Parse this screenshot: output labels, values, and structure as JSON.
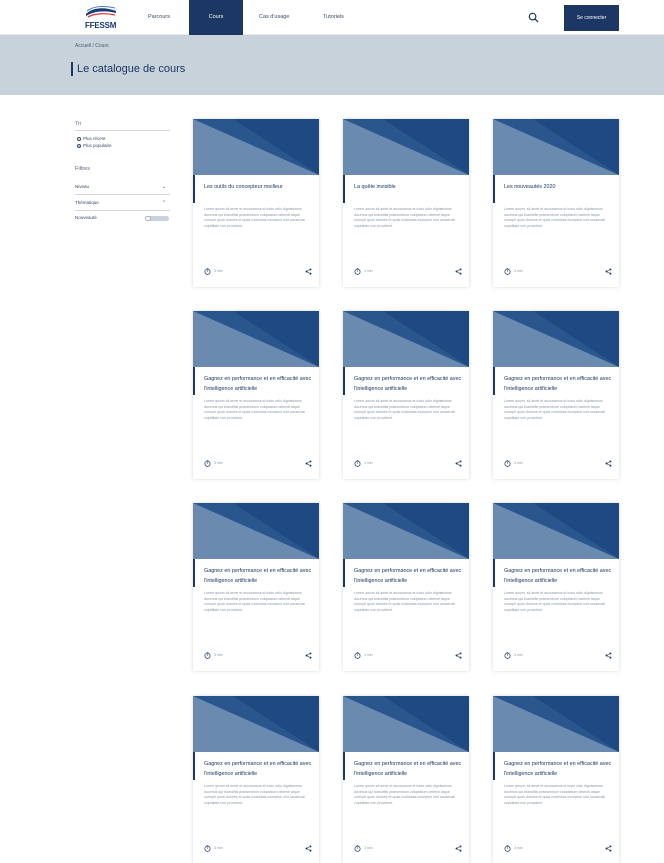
{
  "nav": {
    "logo_text": "FFESSM",
    "links": [
      {
        "label": "Parcours"
      },
      {
        "label": "Cours"
      },
      {
        "label": "Cas d'usage"
      },
      {
        "label": "Tutoriels"
      }
    ],
    "connect_label": "Se connecter"
  },
  "hero": {
    "breadcrumb": "Accueil / Cours",
    "title": "Le catalogue de cours"
  },
  "sidebar": {
    "sort_heading": "Tri",
    "sort_options": [
      {
        "label": "Plus récent",
        "checked": false
      },
      {
        "label": "Plus populaire",
        "checked": true
      }
    ],
    "filters_heading": "Filtres",
    "filters": [
      {
        "label": "Niveau"
      },
      {
        "label": "Thématique"
      }
    ],
    "toggle_label": "Nouveauté"
  },
  "colors": {
    "nav_active": "#1c3764",
    "hero_bg": "#c8d2da",
    "card_image_dark": "#1e4a80",
    "card_image_light": "#5b7ca4"
  },
  "cards": [
    {
      "title": "Les outils du concepteur meilleur",
      "desc": "Lorem ipsum sit amet et accusamus et iusto odio dignissimos ducimus qui blanditiis praesentium voluptatum deleniti atque corrupti quos dolores et quas molestias excepturi sint occaecati cupiditate non provident.",
      "duration": "3 min"
    },
    {
      "title": "La quête invisible",
      "desc": "Lorem ipsum sit amet et accusamus et iusto odio dignissimos ducimus qui blanditiis praesentium voluptatum deleniti atque corrupti quos dolores et quas molestias excepturi sint occaecati cupiditate non provident.",
      "duration": "3 min"
    },
    {
      "title": "Les nouveautés 2020",
      "desc": "Lorem ipsum, sit amet et accusamus et iusto odio dignissimos ducimus qui blanditiis praesentium voluptatum deleniti atque corrupti quos dolores et quas molestias excepturi sint occaecati cupiditate non provident.",
      "duration": "3 min"
    },
    {
      "title": "Gagnez en performance et en efficacité avec l'intelligence artificielle",
      "desc": "Lorem ipsum sit amet et accusamus et iusto odio dignissimos ducimus qui blanditiis praesentium voluptatum deleniti atque corrupti quos dolores et quas molestias excepturi sint occaecati cupiditate non provident.",
      "duration": "3 min"
    },
    {
      "title": "Gagnez en performance et en efficacité avec l'intelligence artificielle",
      "desc": "Lorem ipsum sit amet et accusamus et iusto odio dignissimos ducimus qui blanditiis praesentium voluptatum deleniti atque corrupti quos dolores et quas molestias excepturi sint occaecati cupiditate non provident.",
      "duration": "3 min"
    },
    {
      "title": "Gagnez en performance et en efficacité avec l'intelligence artificielle",
      "desc": "Lorem ipsum, sit amet et accusamus et iusto odio dignissimos ducimus qui blanditiis praesentium voluptatum deleniti atque corrupti quos dolores et quas molestias excepturi sint occaecati cupiditate non provident.",
      "duration": "3 min"
    },
    {
      "title": "Gagnez en performance et en efficacité avec l'intelligence artificielle",
      "desc": "Lorem ipsum sit amet et accusamus et iusto odio dignissimos ducimus qui blanditiis praesentium voluptatum deleniti atque corrupti quos dolores et quas molestias excepturi sint occaecati cupiditate non provident.",
      "duration": "3 min"
    },
    {
      "title": "Gagnez en performance et en efficacité avec l'intelligence artificielle",
      "desc": "Lorem ipsum sit amet et accusamus et iusto odio dignissimos ducimus qui blanditiis praesentium voluptatum deleniti atque corrupti quos dolores et quas molestias excepturi sint occaecati cupiditate non provident.",
      "duration": "3 min"
    },
    {
      "title": "Gagnez en performance et en efficacité avec l'intelligence artificielle",
      "desc": "Lorem ipsum, sit amet et accusamus et iusto odio dignissimos ducimus qui blanditiis praesentium voluptatum deleniti atque corrupti quos dolores et quas molestias excepturi sint occaecati cupiditate non provident.",
      "duration": "3 min"
    },
    {
      "title": "Gagnez en performance et en efficacité avec l'intelligence artificielle",
      "desc": "Lorem ipsum sit amet et accusamus et iusto odio dignissimos ducimus qui blanditiis praesentium voluptatum deleniti atque corrupti quos dolores et quas molestias excepturi sint occaecati cupiditate non provident.",
      "duration": "3 min"
    },
    {
      "title": "Gagnez en performance et en efficacité avec l'intelligence artificielle",
      "desc": "Lorem ipsum sit amet et accusamus et iusto odio dignissimos ducimus qui blanditiis praesentium voluptatum deleniti atque corrupti quos dolores et quas molestias excepturi sint occaecati cupiditate non provident.",
      "duration": "3 min"
    },
    {
      "title": "Gagnez en performance et en efficacité avec l'intelligence artificielle",
      "desc": "Lorem ipsum, sit amet et accusamus et iusto odio dignissimos ducimus qui blanditiis praesentium voluptatum deleniti atque corrupti quos dolores et quas molestias excepturi sint occaecati cupiditate non provident.",
      "duration": "3 min"
    }
  ]
}
